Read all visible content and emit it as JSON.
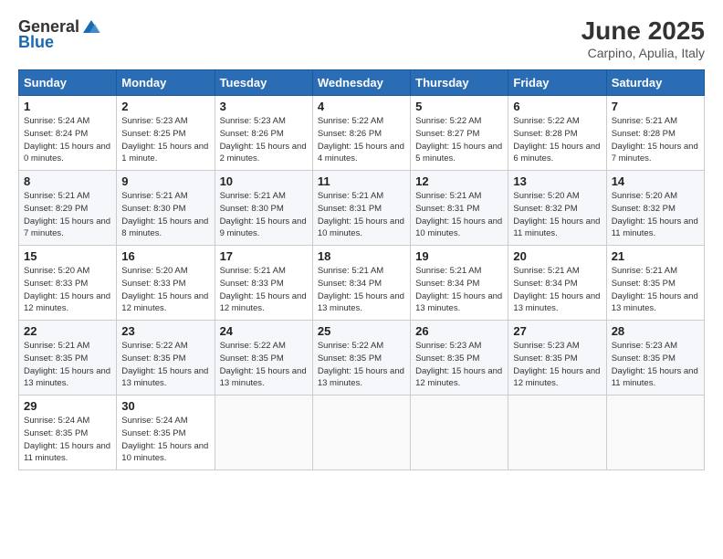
{
  "logo": {
    "general": "General",
    "blue": "Blue"
  },
  "title": "June 2025",
  "subtitle": "Carpino, Apulia, Italy",
  "headers": [
    "Sunday",
    "Monday",
    "Tuesday",
    "Wednesday",
    "Thursday",
    "Friday",
    "Saturday"
  ],
  "weeks": [
    [
      {
        "day": "1",
        "sunrise": "5:24 AM",
        "sunset": "8:24 PM",
        "daylight": "15 hours and 0 minutes."
      },
      {
        "day": "2",
        "sunrise": "5:23 AM",
        "sunset": "8:25 PM",
        "daylight": "15 hours and 1 minute."
      },
      {
        "day": "3",
        "sunrise": "5:23 AM",
        "sunset": "8:26 PM",
        "daylight": "15 hours and 2 minutes."
      },
      {
        "day": "4",
        "sunrise": "5:22 AM",
        "sunset": "8:26 PM",
        "daylight": "15 hours and 4 minutes."
      },
      {
        "day": "5",
        "sunrise": "5:22 AM",
        "sunset": "8:27 PM",
        "daylight": "15 hours and 5 minutes."
      },
      {
        "day": "6",
        "sunrise": "5:22 AM",
        "sunset": "8:28 PM",
        "daylight": "15 hours and 6 minutes."
      },
      {
        "day": "7",
        "sunrise": "5:21 AM",
        "sunset": "8:28 PM",
        "daylight": "15 hours and 7 minutes."
      }
    ],
    [
      {
        "day": "8",
        "sunrise": "5:21 AM",
        "sunset": "8:29 PM",
        "daylight": "15 hours and 7 minutes."
      },
      {
        "day": "9",
        "sunrise": "5:21 AM",
        "sunset": "8:30 PM",
        "daylight": "15 hours and 8 minutes."
      },
      {
        "day": "10",
        "sunrise": "5:21 AM",
        "sunset": "8:30 PM",
        "daylight": "15 hours and 9 minutes."
      },
      {
        "day": "11",
        "sunrise": "5:21 AM",
        "sunset": "8:31 PM",
        "daylight": "15 hours and 10 minutes."
      },
      {
        "day": "12",
        "sunrise": "5:21 AM",
        "sunset": "8:31 PM",
        "daylight": "15 hours and 10 minutes."
      },
      {
        "day": "13",
        "sunrise": "5:20 AM",
        "sunset": "8:32 PM",
        "daylight": "15 hours and 11 minutes."
      },
      {
        "day": "14",
        "sunrise": "5:20 AM",
        "sunset": "8:32 PM",
        "daylight": "15 hours and 11 minutes."
      }
    ],
    [
      {
        "day": "15",
        "sunrise": "5:20 AM",
        "sunset": "8:33 PM",
        "daylight": "15 hours and 12 minutes."
      },
      {
        "day": "16",
        "sunrise": "5:20 AM",
        "sunset": "8:33 PM",
        "daylight": "15 hours and 12 minutes."
      },
      {
        "day": "17",
        "sunrise": "5:21 AM",
        "sunset": "8:33 PM",
        "daylight": "15 hours and 12 minutes."
      },
      {
        "day": "18",
        "sunrise": "5:21 AM",
        "sunset": "8:34 PM",
        "daylight": "15 hours and 13 minutes."
      },
      {
        "day": "19",
        "sunrise": "5:21 AM",
        "sunset": "8:34 PM",
        "daylight": "15 hours and 13 minutes."
      },
      {
        "day": "20",
        "sunrise": "5:21 AM",
        "sunset": "8:34 PM",
        "daylight": "15 hours and 13 minutes."
      },
      {
        "day": "21",
        "sunrise": "5:21 AM",
        "sunset": "8:35 PM",
        "daylight": "15 hours and 13 minutes."
      }
    ],
    [
      {
        "day": "22",
        "sunrise": "5:21 AM",
        "sunset": "8:35 PM",
        "daylight": "15 hours and 13 minutes."
      },
      {
        "day": "23",
        "sunrise": "5:22 AM",
        "sunset": "8:35 PM",
        "daylight": "15 hours and 13 minutes."
      },
      {
        "day": "24",
        "sunrise": "5:22 AM",
        "sunset": "8:35 PM",
        "daylight": "15 hours and 13 minutes."
      },
      {
        "day": "25",
        "sunrise": "5:22 AM",
        "sunset": "8:35 PM",
        "daylight": "15 hours and 13 minutes."
      },
      {
        "day": "26",
        "sunrise": "5:23 AM",
        "sunset": "8:35 PM",
        "daylight": "15 hours and 12 minutes."
      },
      {
        "day": "27",
        "sunrise": "5:23 AM",
        "sunset": "8:35 PM",
        "daylight": "15 hours and 12 minutes."
      },
      {
        "day": "28",
        "sunrise": "5:23 AM",
        "sunset": "8:35 PM",
        "daylight": "15 hours and 11 minutes."
      }
    ],
    [
      {
        "day": "29",
        "sunrise": "5:24 AM",
        "sunset": "8:35 PM",
        "daylight": "15 hours and 11 minutes."
      },
      {
        "day": "30",
        "sunrise": "5:24 AM",
        "sunset": "8:35 PM",
        "daylight": "15 hours and 10 minutes."
      },
      null,
      null,
      null,
      null,
      null
    ]
  ]
}
